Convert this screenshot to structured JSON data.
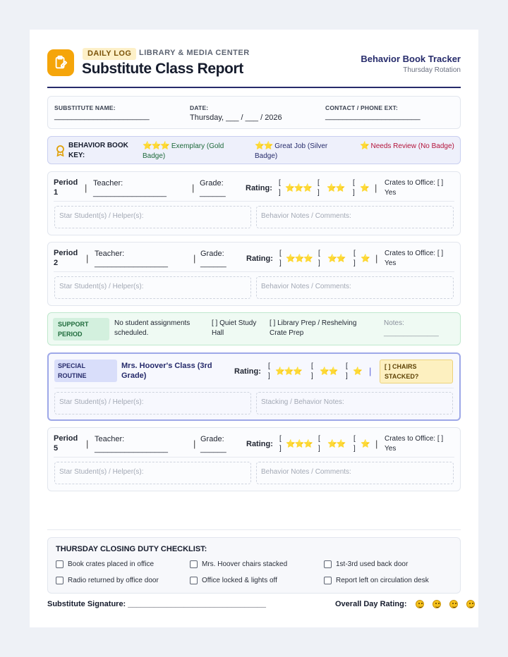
{
  "header": {
    "pill": "DAILY LOG",
    "org": "LIBRARY & MEDIA CENTER",
    "title": "Substitute Class Report",
    "tracker": "Behavior Book Tracker",
    "rotation": "Thursday Rotation",
    "logo_icon": "clipboard-pencil-icon",
    "accent": "#262b6b",
    "logo_color": "#f5a50a"
  },
  "info": {
    "substitute_label": "SUBSTITUTE NAME:",
    "substitute_value": "______________________",
    "date_label": "DATE:",
    "date_value": "Thursday, ___ / ___ / 2026",
    "contact_label": "CONTACT / PHONE EXT:",
    "contact_value": "______________________"
  },
  "key": {
    "label": "BEHAVIOR BOOK KEY:",
    "gold_stars": "⭐⭐⭐",
    "gold_text": "Exemplary (Gold Badge)",
    "silver_stars": "⭐⭐",
    "silver_text": "Great Job (Silver Badge)",
    "review_star": "⭐",
    "review_text": "Needs Review (No Badge)",
    "gold_color": "#1e6a3b",
    "silver_color": "#262b6b",
    "review_color": "#b3133b"
  },
  "common": {
    "teacher": "Teacher: _________________",
    "grade": "Grade: ______",
    "rating": "Rating:",
    "bracket_open": "[",
    "bracket_close": "]",
    "stars3": "⭐⭐⭐",
    "stars2": "⭐⭐",
    "stars1": "⭐",
    "sep": "|",
    "crates": "Crates to Office: [ ] Yes",
    "star_students": "Star Student(s) / Helper(s):",
    "notes": "Behavior Notes / Comments:"
  },
  "period1": {
    "name": "Period 1"
  },
  "period2": {
    "name": "Period 2"
  },
  "period5": {
    "name": "Period 5"
  },
  "support": {
    "tag": "SUPPORT PERIOD",
    "assign": "No student assignments scheduled.",
    "quiet": "[ ] Quiet Study Hall",
    "prep": "[ ] Library Prep / Reshelving Crate Prep",
    "notes": "Notes: ______________"
  },
  "special": {
    "tag": "SPECIAL ROUTINE",
    "cls": "Mrs. Hoover's Class (3rd Grade)",
    "chairs": "[ ] CHAIRS STACKED?",
    "stacking": "Stacking / Behavior Notes:"
  },
  "checklist": {
    "title": "THURSDAY CLOSING DUTY CHECKLIST:",
    "items": [
      "Book crates placed in office",
      "Mrs. Hoover chairs stacked",
      "1st-3rd used back door",
      "Radio returned by office door",
      "Office locked & lights off",
      "Report left on circulation desk"
    ]
  },
  "footer": {
    "signature": "Substitute Signature: ________________________________",
    "overall": "Overall Day Rating:",
    "rating_icons": [
      "smiley-face-icon",
      "smiley-face-icon",
      "smiley-face-icon",
      "smiley-face-icon"
    ]
  }
}
